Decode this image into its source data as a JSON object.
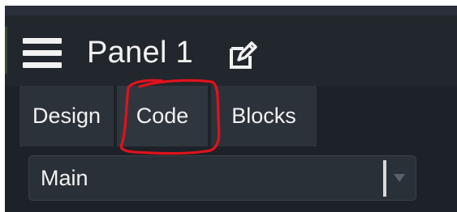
{
  "header": {
    "menu_icon": "hamburger-menu-icon",
    "title": "Panel 1",
    "edit_icon": "edit-pencil-icon"
  },
  "tabs": [
    {
      "label": "Design",
      "selected": false
    },
    {
      "label": "Code",
      "selected": true
    },
    {
      "label": "Blocks",
      "selected": false
    }
  ],
  "annotation": {
    "shape": "hand-drawn circle around Code tab",
    "color": "#e0121b"
  },
  "dropdown": {
    "value": "Main",
    "caret_icon": "chevron-down-icon"
  },
  "colors": {
    "background": "#1d2228",
    "header": "#22272d",
    "tab": "#2c323a",
    "text": "#f2f2f2",
    "annotation_red": "#e0121b"
  }
}
